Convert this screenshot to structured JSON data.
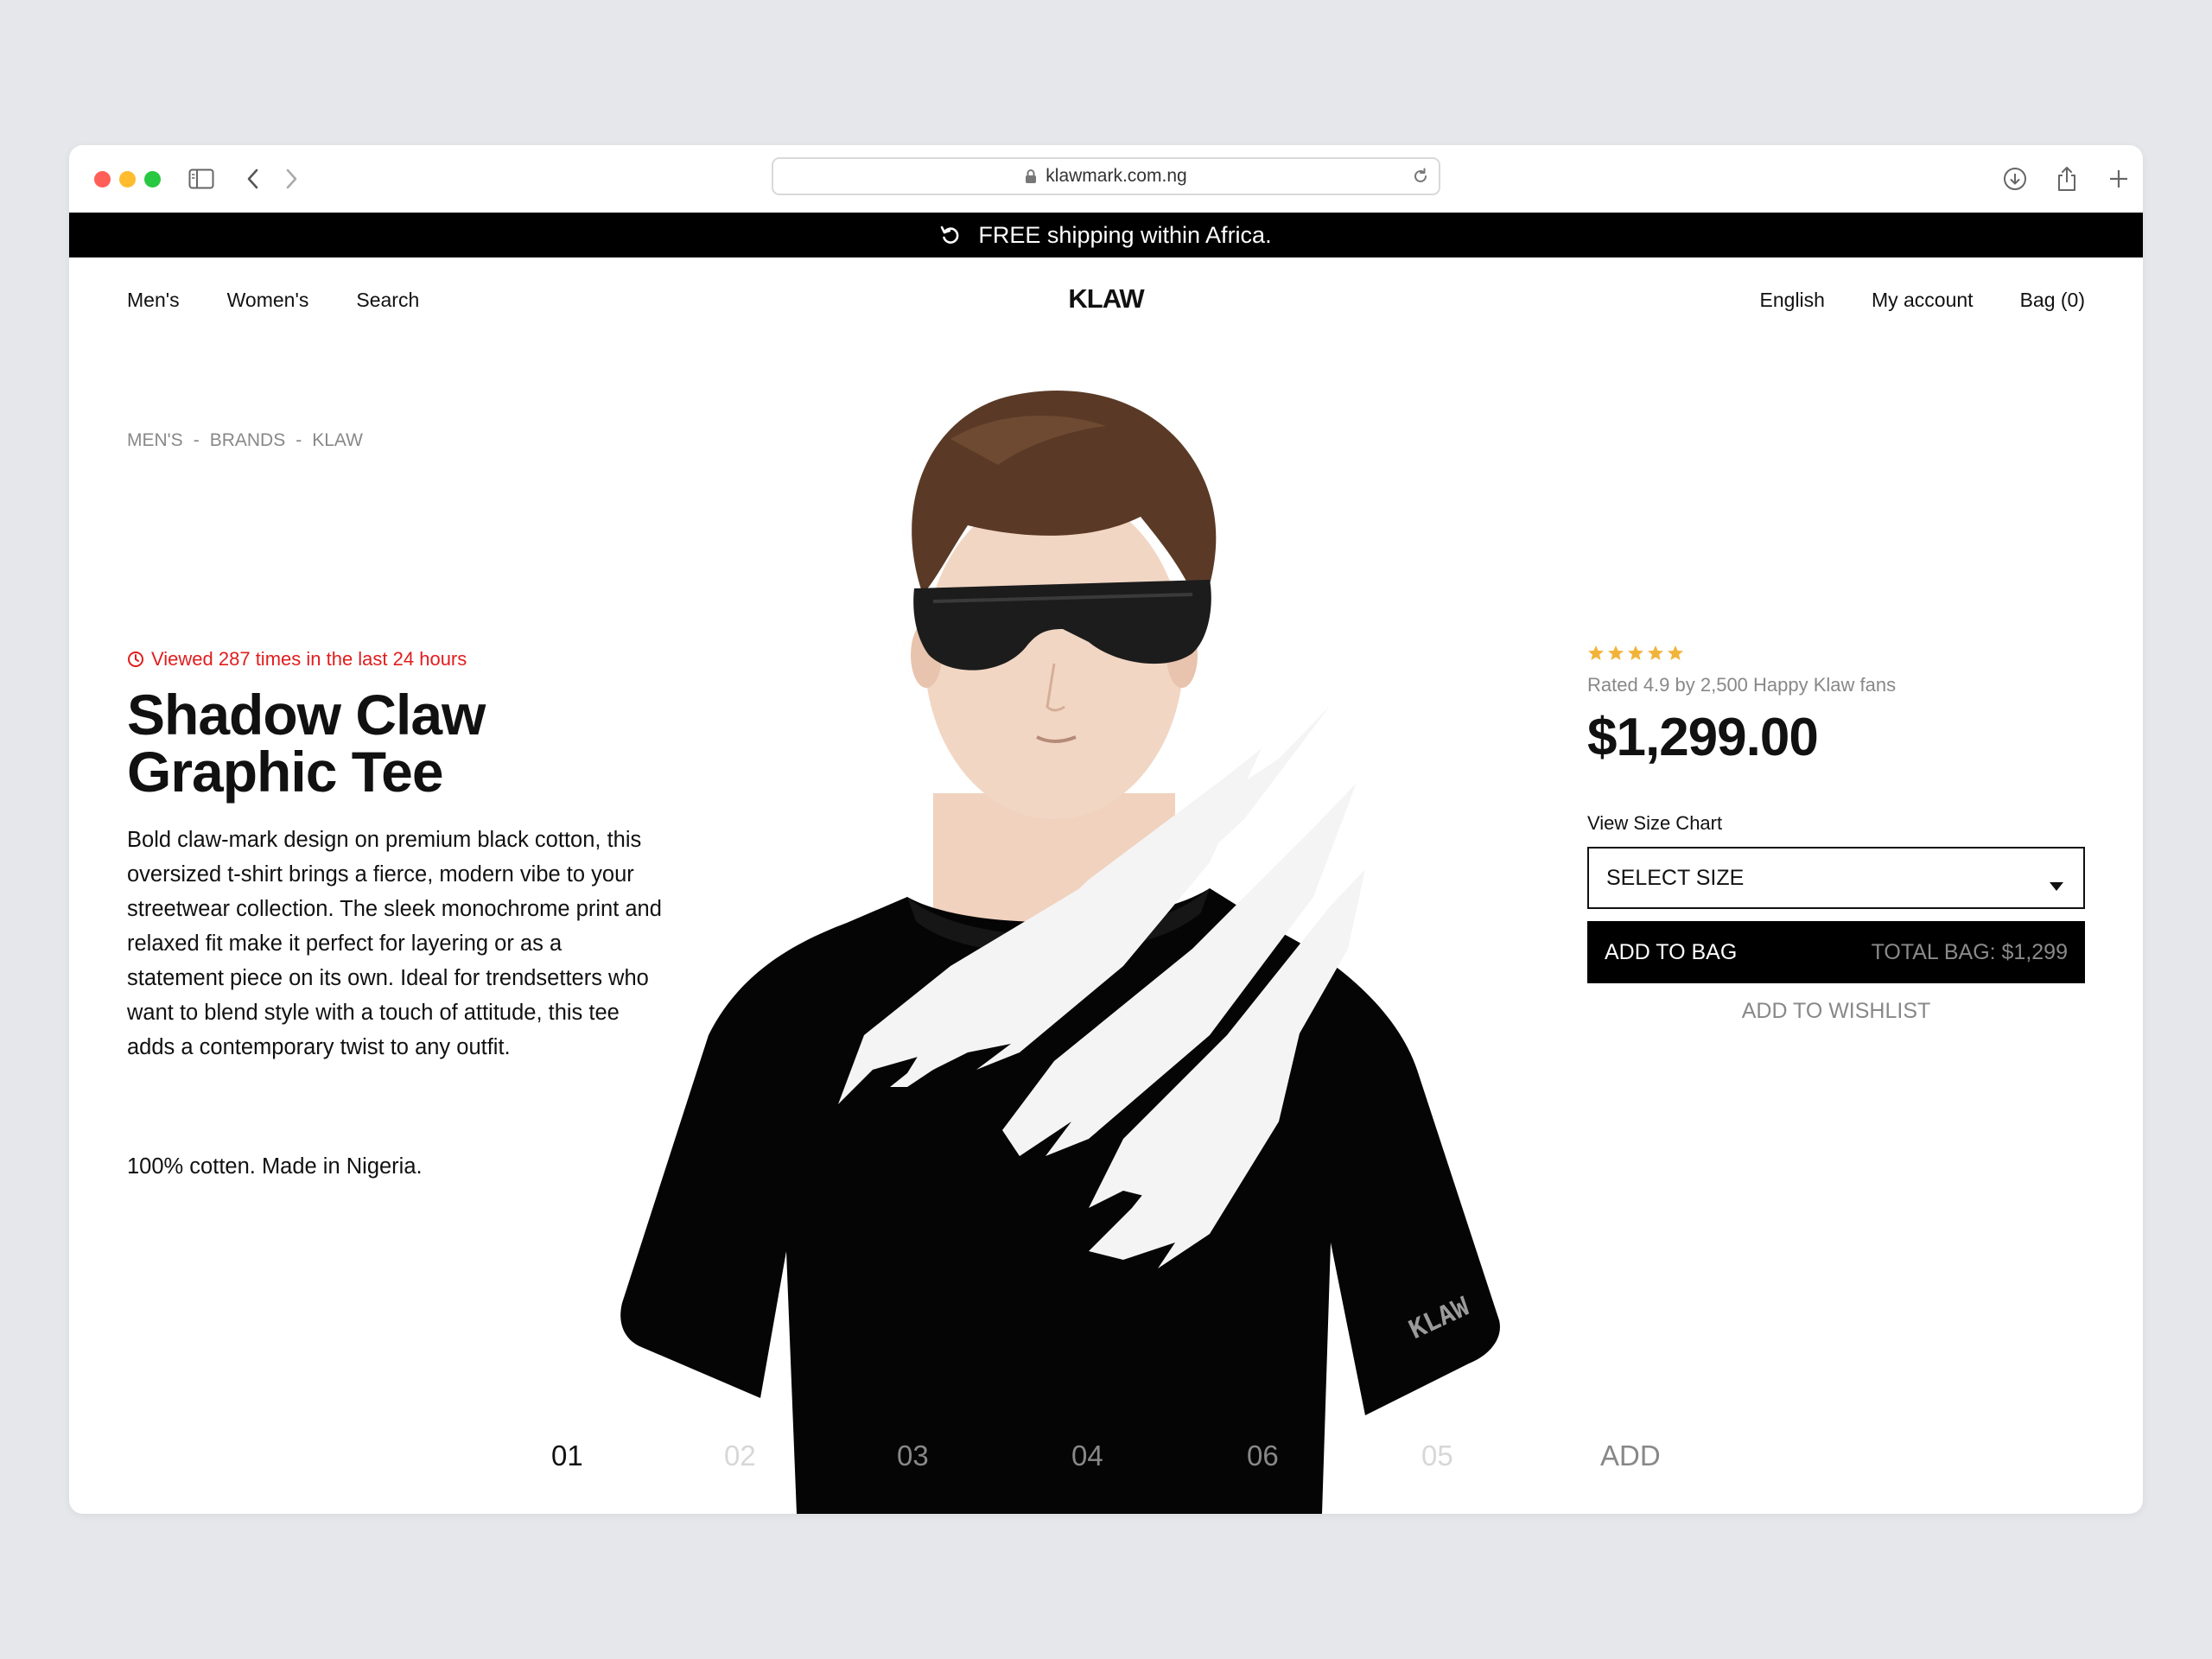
{
  "browser": {
    "url": "klawmark.com.ng"
  },
  "promo": {
    "text": "FREE shipping within Africa."
  },
  "nav": {
    "left": [
      "Men's",
      "Women's",
      "Search"
    ],
    "logo": "KLAW",
    "right": [
      "English",
      "My account",
      "Bag (0)"
    ]
  },
  "breadcrumb": [
    "MEN'S",
    "-",
    "BRANDS",
    "-",
    "KLAW"
  ],
  "product": {
    "viewed": "Viewed 287 times in the last 24 hours",
    "title_line1": "Shadow Claw",
    "title_line2": "Graphic Tee",
    "description": "Bold claw-mark design on premium black cotton, this oversized t-shirt brings a fierce, modern vibe to your streetwear collection. The sleek monochrome print and relaxed fit make it perfect for layering or as a statement piece on its own. Ideal for trendsetters who want to blend style with a touch of attitude, this tee adds a contemporary twist to any outfit.",
    "material": "100% cotten. Made in Nigeria.",
    "rating_stars": 5,
    "rating_text": "Rated 4.9 by 2,500 Happy Klaw fans",
    "price": "$1,299.00",
    "size_chart_label": "View Size Chart",
    "size_select": "SELECT SIZE",
    "add_to_bag": "ADD TO BAG",
    "total_bag": "TOTAL BAG: $1,299",
    "add_to_wishlist": "ADD TO WISHLIST",
    "sleeve_print": "KLAW"
  },
  "thumbnails": [
    "01",
    "02",
    "03",
    "04",
    "06",
    "05",
    "ADD"
  ],
  "colors": {
    "accent_red": "#e11d1d",
    "star": "#f2b33a",
    "promo_bg": "#000000"
  }
}
